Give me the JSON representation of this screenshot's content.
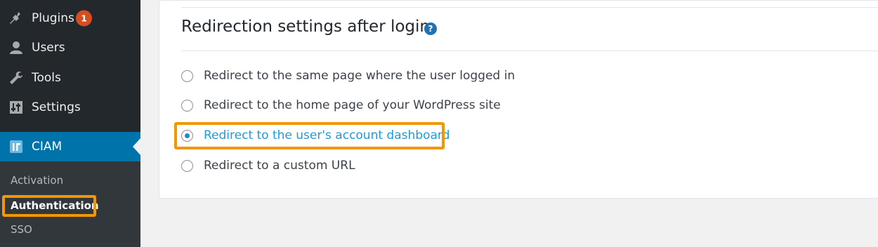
{
  "sidebar": {
    "items": [
      {
        "label": "Plugins",
        "icon": "plug-icon",
        "badge": "1"
      },
      {
        "label": "Users",
        "icon": "user-icon"
      },
      {
        "label": "Tools",
        "icon": "wrench-icon"
      },
      {
        "label": "Settings",
        "icon": "sliders-icon"
      },
      {
        "label": "CIAM",
        "icon": "ciam-logo-icon",
        "current": true
      }
    ],
    "submenu": [
      {
        "label": "Activation"
      },
      {
        "label": "Authentication",
        "active": true
      },
      {
        "label": "SSO"
      }
    ]
  },
  "section": {
    "title": "Redirection settings after login",
    "help_icon": "?",
    "options": [
      {
        "label": "Redirect to the same page where the user logged in",
        "checked": false
      },
      {
        "label": "Redirect to the home page of your WordPress site",
        "checked": false
      },
      {
        "label": "Redirect to the user's account dashboard",
        "checked": true
      },
      {
        "label": "Redirect to a custom URL",
        "checked": false
      }
    ]
  },
  "colors": {
    "sidebar_bg": "#23282d",
    "current_bg": "#0073aa",
    "highlight": "#f29603",
    "badge": "#d54e21",
    "selected_text": "#1e9bd6"
  }
}
